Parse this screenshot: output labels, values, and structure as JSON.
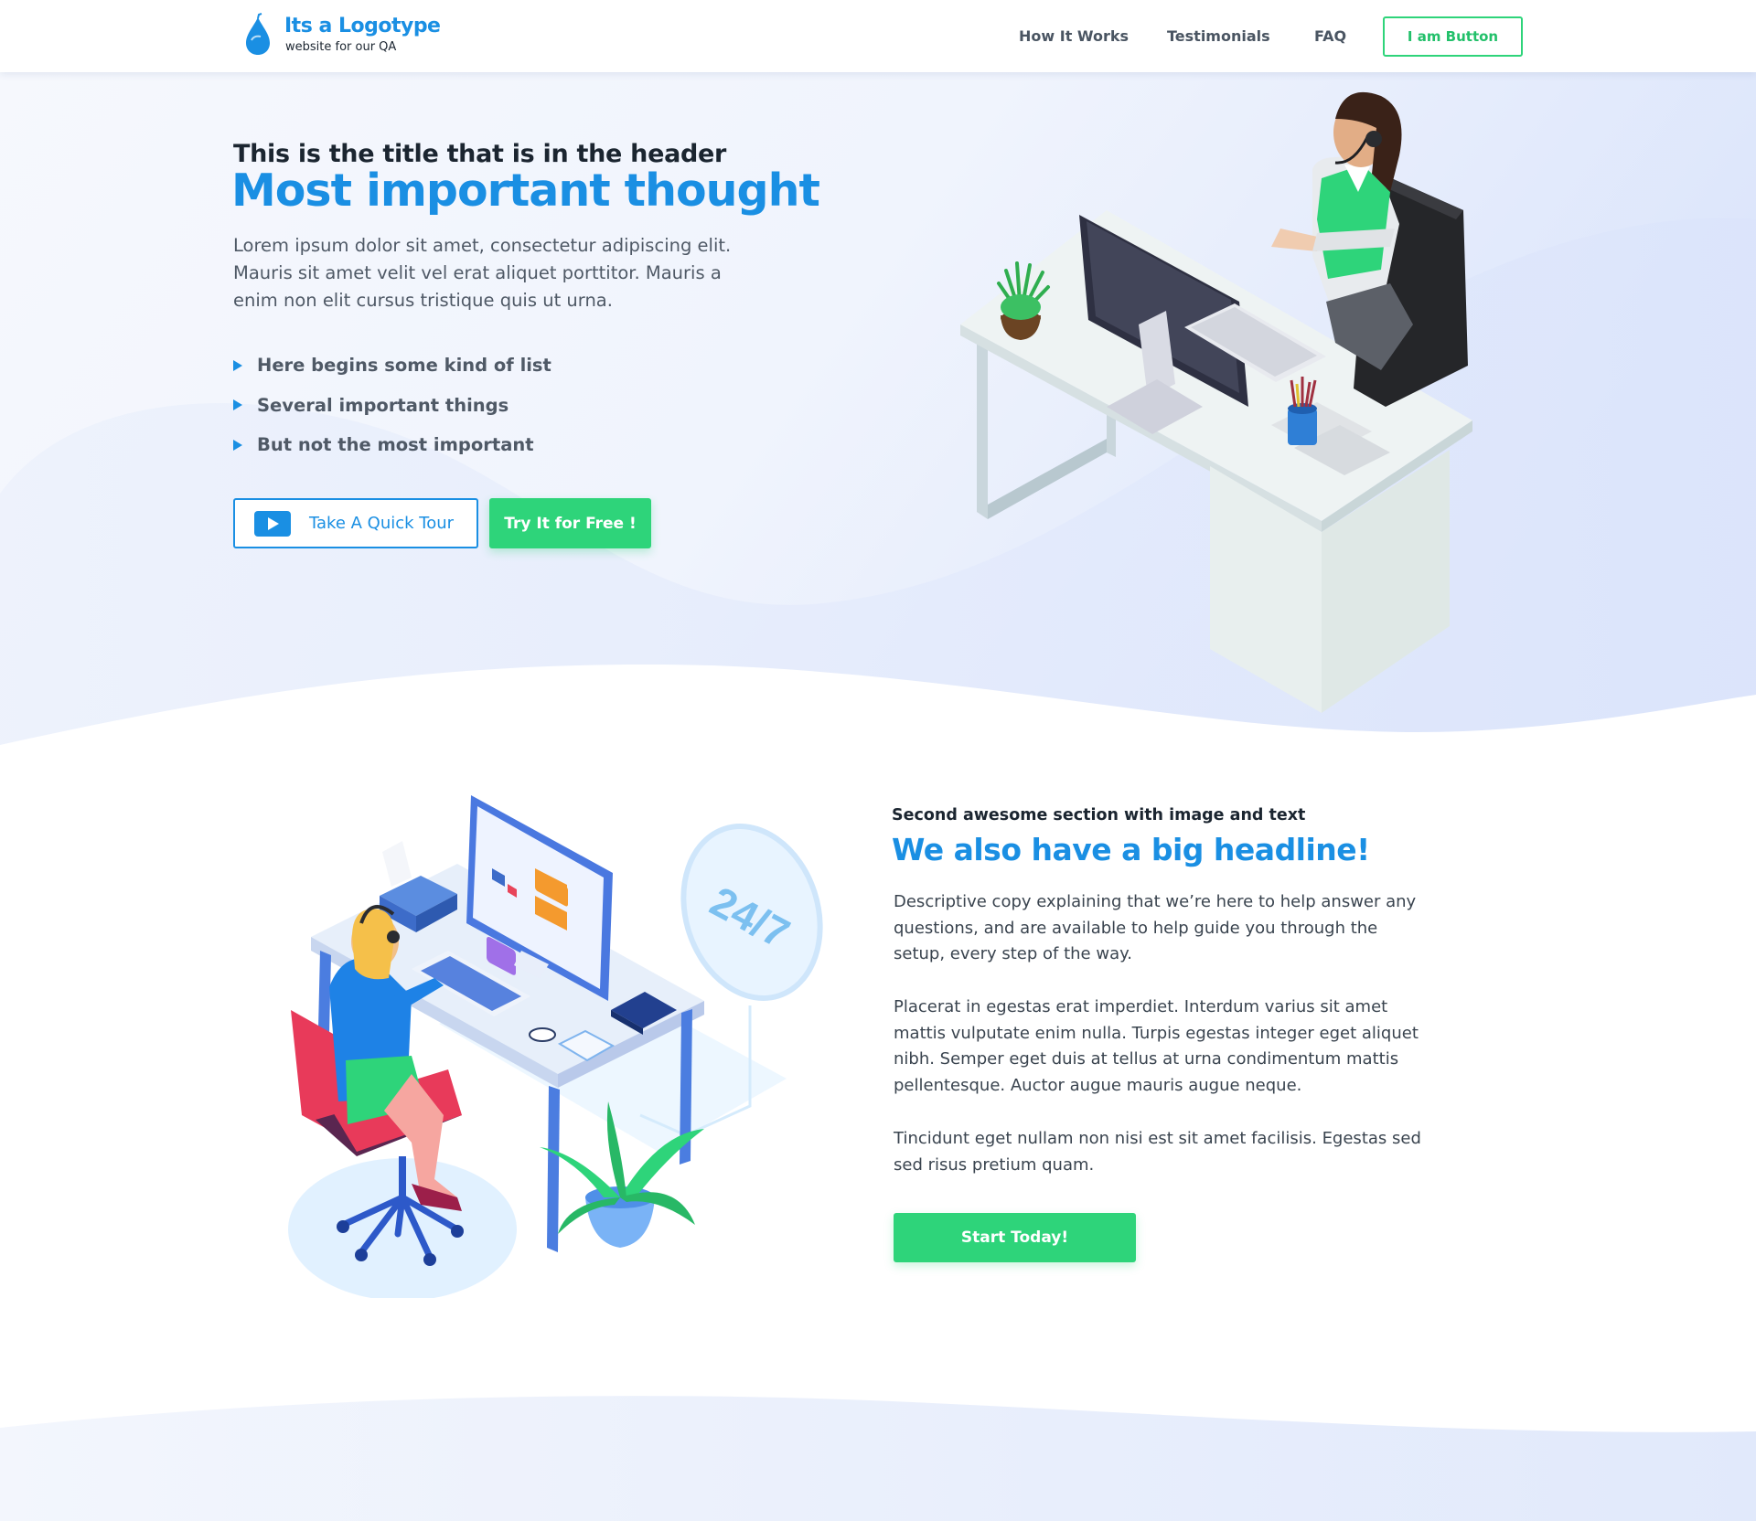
{
  "header": {
    "logo_title": "Its a Logotype",
    "logo_subtitle": "website for our QA",
    "nav": [
      "How It Works",
      "Testimonials",
      "FAQ"
    ],
    "cta_label": "I am Button"
  },
  "hero": {
    "subtitle": "This is the title that is in the header",
    "title": "Most important thought",
    "description": "Lorem ipsum dolor sit amet, consectetur adipiscing elit. Mauris sit amet velit vel erat aliquet porttitor. Mauris a enim non elit cursus tristique quis ut urna.",
    "list": [
      "Here begins some kind of list",
      "Several important things",
      "But not the most important"
    ],
    "tour_button": "Take A Quick Tour",
    "free_button": "Try It for Free !",
    "illustration": "support-agent-desk-illustration"
  },
  "section2": {
    "eyebrow": "Second awesome section with image and text",
    "title": "We also have a big headline!",
    "paragraphs": [
      "Descriptive copy explaining that we’re here to help answer any questions, and are available to help guide you through the setup, every step of the way.",
      "Placerat in egestas erat imperdiet. Interdum varius sit amet mattis vulputate enim nulla. Turpis egestas integer eget aliquet nibh. Semper eget duis at tellus at urna condimentum mattis pellentesque. Auctor augue mauris augue neque.",
      "Tincidunt eget nullam non nisi est sit amet facilisis. Egestas sed sed risus pretium quam."
    ],
    "badge_text": "24/7",
    "start_button": "Start Today!",
    "illustration": "call-center-workstation-illustration"
  },
  "colors": {
    "brand_blue": "#1a8fe3",
    "accent_green": "#2ed47a",
    "text_dark": "#1b2530",
    "text_body": "#4f5966"
  }
}
